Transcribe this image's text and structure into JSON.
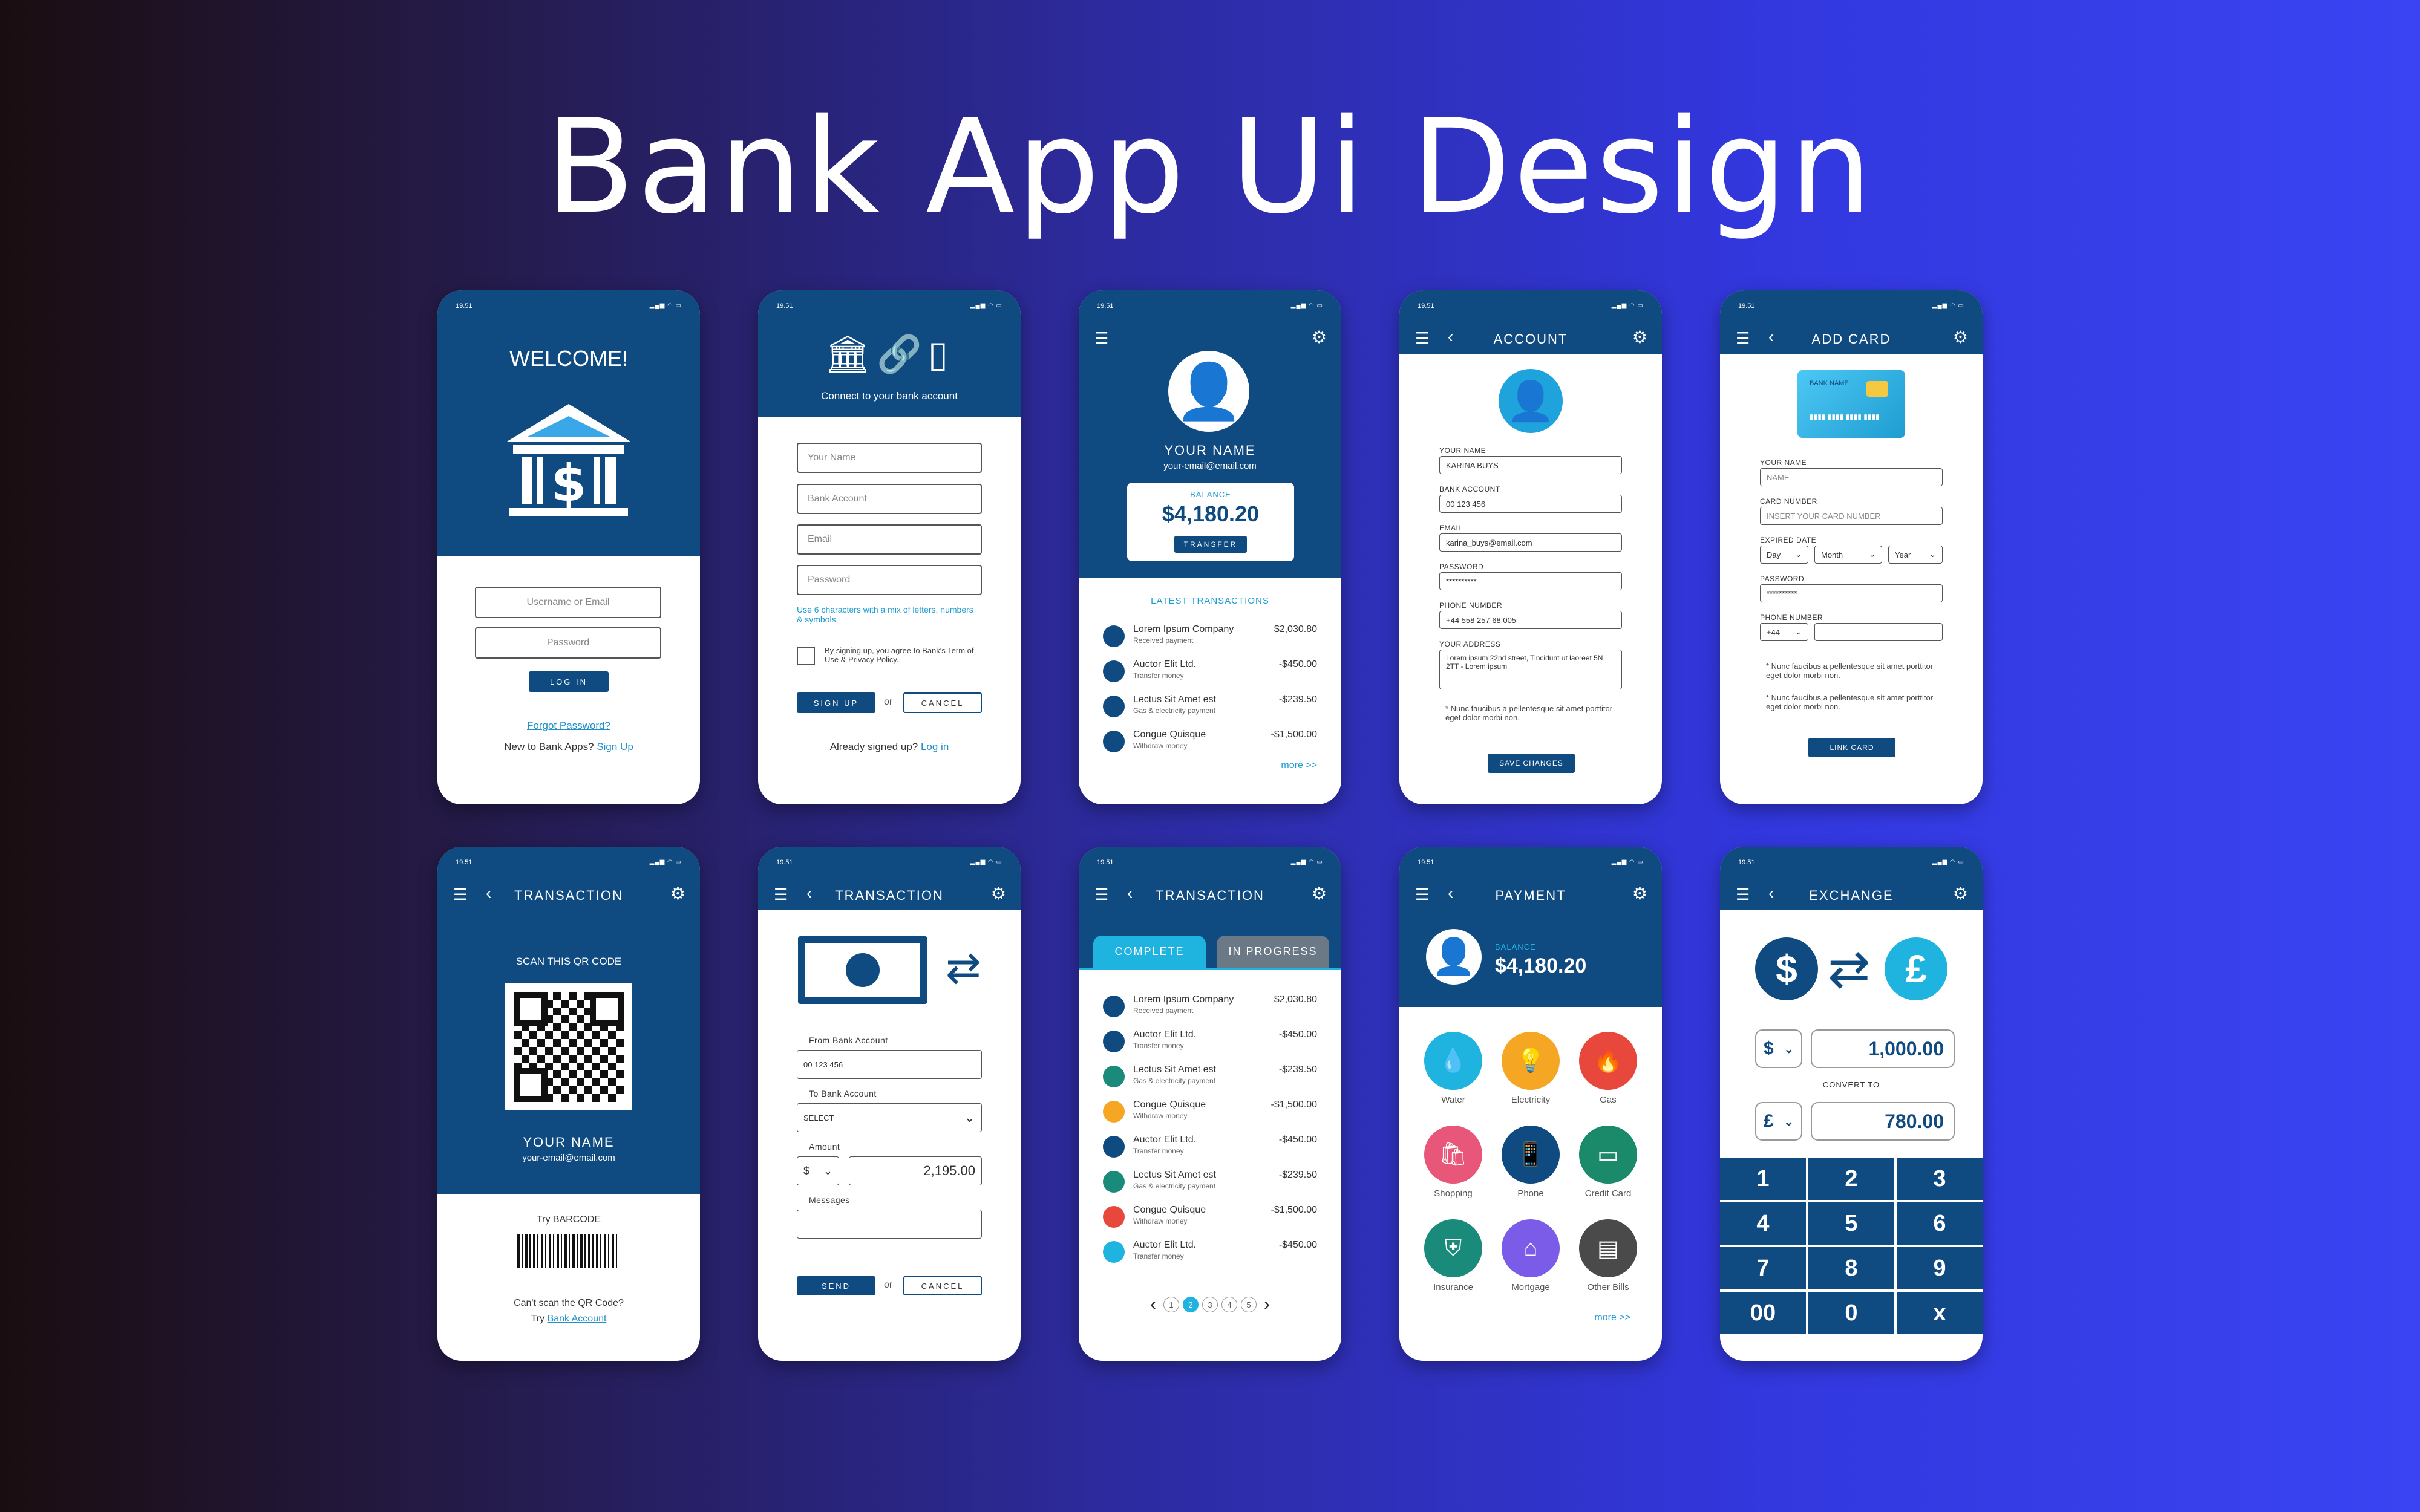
{
  "title": "Bank App Ui Design",
  "status_time": "19.51",
  "status_icons": "▂▄▆ ◠ ▭",
  "s1": {
    "welcome": "WELCOME!",
    "username_ph": "Username or Email",
    "password_ph": "Password",
    "login": "LOG IN",
    "forgot": "Forgot Password?",
    "new_text": "New to Bank Apps?",
    "signup": "Sign Up"
  },
  "s2": {
    "connect": "Connect to your bank account",
    "name_ph": "Your Name",
    "bank_ph": "Bank Account",
    "email_ph": "Email",
    "password_ph": "Password",
    "hint": "Use 6 characters with a mix of letters, numbers & symbols.",
    "agree": "By signing up, you agree to Bank's Term of Use & Privacy Policy.",
    "signup": "SIGN UP",
    "or": "or",
    "cancel": "CANCEL",
    "already": "Already signed up?",
    "login": "Log in"
  },
  "s3": {
    "name": "YOUR NAME",
    "email": "your-email@email.com",
    "balance_label": "BALANCE",
    "balance": "$4,180.20",
    "transfer": "TRANSFER",
    "latest": "LATEST TRANSACTIONS",
    "more": "more >>",
    "rows": [
      {
        "n": "Lorem Ipsum Company",
        "s": "Received payment",
        "a": "$2,030.80",
        "c": "#0f4a80"
      },
      {
        "n": "Auctor Elit Ltd.",
        "s": "Transfer money",
        "a": "-$450.00",
        "c": "#0f4a80"
      },
      {
        "n": "Lectus Sit Amet est",
        "s": "Gas & electricity payment",
        "a": "-$239.50",
        "c": "#0f4a80"
      },
      {
        "n": "Congue Quisque",
        "s": "Withdraw money",
        "a": "-$1,500.00",
        "c": "#0f4a80"
      }
    ]
  },
  "s4": {
    "nav": "ACCOUNT",
    "name_l": "YOUR NAME",
    "name_v": "KARINA BUYS",
    "bank_l": "BANK ACCOUNT",
    "bank_v": "00 123 456",
    "email_l": "EMAIL",
    "email_v": "karina_buys@email.com",
    "pass_l": "PASSWORD",
    "pass_v": "**********",
    "phone_l": "PHONE NUMBER",
    "phone_v": "+44 558 257 68 005",
    "addr_l": "YOUR ADDRESS",
    "addr_v": "Lorem ipsum 22nd street, Tincidunt ut laoreet 5N 2TT - Lorem ipsum",
    "note": "* Nunc faucibus a pellentesque sit amet porttitor eget dolor morbi non.",
    "save": "SAVE CHANGES"
  },
  "s5": {
    "nav": "ADD CARD",
    "card_bank": "BANK NAME",
    "card_num": "▮▮▮▮ ▮▮▮▮ ▮▮▮▮ ▮▮▮▮",
    "name_l": "YOUR NAME",
    "name_ph": "NAME",
    "num_l": "CARD NUMBER",
    "num_ph": "INSERT YOUR CARD NUMBER",
    "exp_l": "EXPIRED DATE",
    "day": "Day",
    "month": "Month",
    "year": "Year",
    "pass_l": "PASSWORD",
    "pass_v": "**********",
    "phone_l": "PHONE NUMBER",
    "phone_code": "+44",
    "note1": "* Nunc faucibus a pellentesque sit amet porttitor eget dolor morbi non.",
    "note2": "* Nunc faucibus a pellentesque sit amet porttitor eget dolor morbi non.",
    "link": "LINK CARD"
  },
  "s6": {
    "nav": "TRANSACTION",
    "scan": "SCAN THIS QR CODE",
    "name": "YOUR NAME",
    "email": "your-email@email.com",
    "barcode": "Try BARCODE",
    "cant": "Can't scan the QR Code?",
    "try": "Try",
    "bank": "Bank Account"
  },
  "s7": {
    "nav": "TRANSACTION",
    "from_l": "From Bank Account",
    "from_v": "00 123 456",
    "to_l": "To Bank Account",
    "to_v": "SELECT",
    "amount_l": "Amount",
    "cur": "$",
    "amount_v": "2,195.00",
    "msg_l": "Messages",
    "send": "SEND",
    "or": "or",
    "cancel": "CANCEL"
  },
  "s8": {
    "nav": "TRANSACTION",
    "tab1": "COMPLETE",
    "tab2": "IN PROGRESS",
    "rows": [
      {
        "n": "Lorem Ipsum Company",
        "s": "Received payment",
        "a": "$2,030.80",
        "c": "#0f4a80"
      },
      {
        "n": "Auctor Elit Ltd.",
        "s": "Transfer money",
        "a": "-$450.00",
        "c": "#0f4a80"
      },
      {
        "n": "Lectus Sit Amet est",
        "s": "Gas & electricity payment",
        "a": "-$239.50",
        "c": "#1a8a7a"
      },
      {
        "n": "Congue Quisque",
        "s": "Withdraw money",
        "a": "-$1,500.00",
        "c": "#f5a623"
      },
      {
        "n": "Auctor Elit Ltd.",
        "s": "Transfer money",
        "a": "-$450.00",
        "c": "#0f4a80"
      },
      {
        "n": "Lectus Sit Amet est",
        "s": "Gas & electricity payment",
        "a": "-$239.50",
        "c": "#1a8a7a"
      },
      {
        "n": "Congue Quisque",
        "s": "Withdraw money",
        "a": "-$1,500.00",
        "c": "#e8483b"
      },
      {
        "n": "Auctor Elit Ltd.",
        "s": "Transfer money",
        "a": "-$450.00",
        "c": "#1fb3e0"
      }
    ],
    "pages": [
      "1",
      "2",
      "3",
      "4",
      "5"
    ],
    "active_page": "2"
  },
  "s9": {
    "nav": "PAYMENT",
    "balance_label": "BALANCE",
    "balance": "$4,180.20",
    "more": "more >>",
    "icons": [
      {
        "l": "Water",
        "c": "#1fb3e0",
        "g": "💧"
      },
      {
        "l": "Electricity",
        "c": "#f5a623",
        "g": "💡"
      },
      {
        "l": "Gas",
        "c": "#e8483b",
        "g": "🔥"
      },
      {
        "l": "Shopping",
        "c": "#e8577a",
        "g": "🛍"
      },
      {
        "l": "Phone",
        "c": "#0f4a80",
        "g": "📱"
      },
      {
        "l": "Credit Card",
        "c": "#1a8a6a",
        "g": "▭"
      },
      {
        "l": "Insurance",
        "c": "#1a8a7a",
        "g": "⛨"
      },
      {
        "l": "Mortgage",
        "c": "#7a5ce8",
        "g": "⌂"
      },
      {
        "l": "Other Bills",
        "c": "#4a4a4a",
        "g": "▤"
      }
    ]
  },
  "s10": {
    "nav": "EXCHANGE",
    "from_sym": "$",
    "to_sym": "£",
    "cur1": "$",
    "val1": "1,000.00",
    "convert": "CONVERT TO",
    "cur2": "£",
    "val2": "780.00",
    "keys": [
      "1",
      "2",
      "3",
      "4",
      "5",
      "6",
      "7",
      "8",
      "9",
      "00",
      "0",
      "x"
    ]
  }
}
